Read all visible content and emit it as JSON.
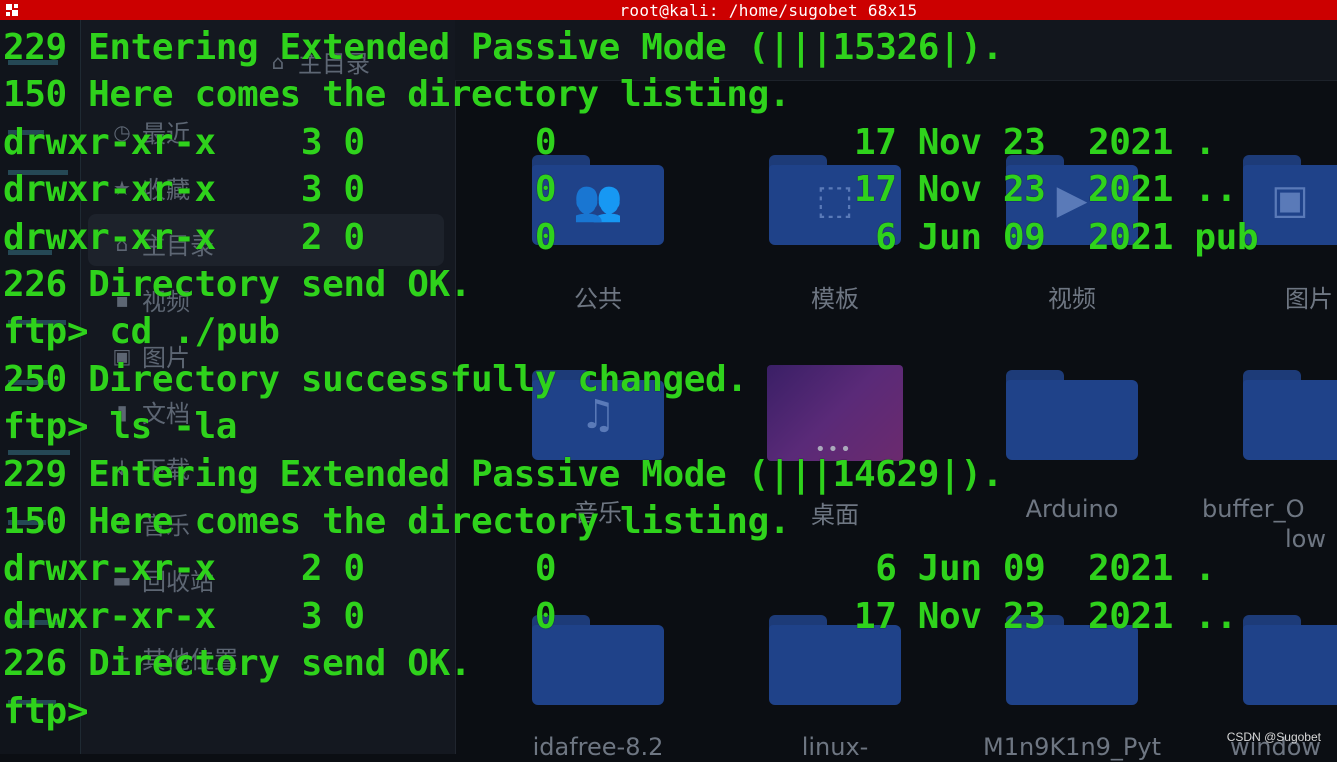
{
  "window": {
    "title": "root@kali: /home/sugobet 68x15",
    "icon": "terminal-app-icon"
  },
  "background_file_manager": {
    "header_breadcrumb": "主目录",
    "sidebar": {
      "items": [
        {
          "label": "最近",
          "icon": "clock-icon"
        },
        {
          "label": "收藏",
          "icon": "star-icon"
        },
        {
          "label": "主目录",
          "icon": "home-icon",
          "selected": true
        },
        {
          "label": "视频",
          "icon": "video-icon"
        },
        {
          "label": "图片",
          "icon": "image-icon"
        },
        {
          "label": "文档",
          "icon": "document-icon"
        },
        {
          "label": "下载",
          "icon": "download-icon"
        },
        {
          "label": "音乐",
          "icon": "music-icon"
        },
        {
          "label": "回收站",
          "icon": "trash-icon"
        },
        {
          "label": "其他位置",
          "icon": "plus-icon"
        }
      ]
    },
    "folders": [
      {
        "label": "公共",
        "icon": "people-icon"
      },
      {
        "label": "模板",
        "icon": "template-icon"
      },
      {
        "label": "视频",
        "icon": "video-icon"
      },
      {
        "label": "图片",
        "icon": "image-icon"
      },
      {
        "label": "音乐",
        "icon": "music-icon"
      },
      {
        "label": "桌面",
        "icon": "desktop-icon"
      },
      {
        "label": "Arduino",
        "icon": "folder-icon"
      },
      {
        "label": "buffer_O",
        "label2": "low",
        "icon": "folder-icon"
      },
      {
        "label": "idafree-8.2",
        "icon": "folder-icon"
      },
      {
        "label": "linux-",
        "icon": "folder-icon"
      },
      {
        "label": "M1n9K1n9_Pyt",
        "icon": "folder-icon"
      },
      {
        "label": "window",
        "icon": "folder-icon"
      }
    ]
  },
  "terminal": {
    "lines": [
      "229 Entering Extended Passive Mode (|||15326|).",
      "150 Here comes the directory listing.",
      "drwxr-xr-x    3 0        0              17 Nov 23  2021 .",
      "drwxr-xr-x    3 0        0              17 Nov 23  2021 ..",
      "drwxr-xr-x    2 0        0               6 Jun 09  2021 pub",
      "226 Directory send OK.",
      "ftp> cd ./pub",
      "250 Directory successfully changed.",
      "ftp> ls -la",
      "229 Entering Extended Passive Mode (|||14629|).",
      "150 Here comes the directory listing.",
      "drwxr-xr-x    2 0        0               6 Jun 09  2021 .",
      "drwxr-xr-x    3 0        0              17 Nov 23  2021 ..",
      "226 Directory send OK.",
      "ftp> "
    ],
    "text_color": "#2fd21c"
  },
  "watermark": "CSDN @Sugobet",
  "colors": {
    "titlebar": "#cc0000",
    "background": "#0b0e13",
    "folder": "#1f4289"
  }
}
